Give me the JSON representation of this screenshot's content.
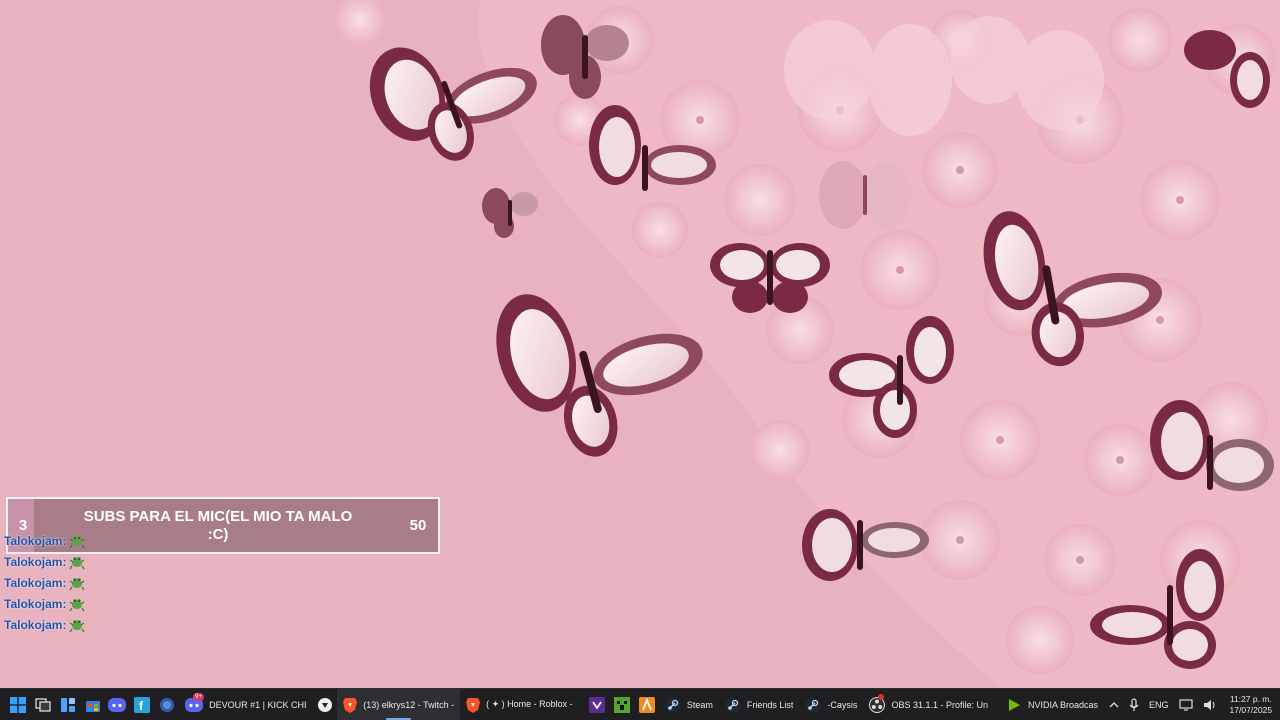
{
  "sub_goal": {
    "current": "3",
    "target": "50",
    "title": "SUBS PARA EL MIC(EL MIO TA MALO :C)",
    "progress": 0.06
  },
  "chat": {
    "lines": [
      {
        "user": "Talokojam:",
        "emote": "frog-dance-emote"
      },
      {
        "user": "Talokojam:",
        "emote": "frog-dance-emote"
      },
      {
        "user": "Talokojam:",
        "emote": "frog-dance-emote"
      },
      {
        "user": "Talokojam:",
        "emote": "frog-dance-emote"
      },
      {
        "user": "Talokojam:",
        "emote": "frog-dance-emote"
      }
    ]
  },
  "taskbar": {
    "apps": {
      "discord_devour": {
        "label": "DEVOUR #1 | KICK CHI",
        "badge": "9+"
      },
      "brave_twitch": {
        "label": "(13) elkrys12 - Twitch -"
      },
      "brave_roblox": {
        "label": "( ✦ ) Home - Roblox -"
      },
      "steam": {
        "label": "Steam"
      },
      "friends": {
        "label": "Friends List"
      },
      "caysis": {
        "label": "-Caysis"
      },
      "obs": {
        "label": "OBS 31.1.1 - Profile: Un"
      },
      "nvidia": {
        "label": "NVIDIA Broadcas"
      }
    },
    "tray": {
      "language": "ENG",
      "time": "11:27 p. m.",
      "date": "17/07/2025"
    }
  },
  "colors": {
    "wallpaper": "#e9b6c0",
    "taskbar": "#1f1f22",
    "goal_fill": "#cd96af",
    "chat_user": "#2b4f9c"
  }
}
